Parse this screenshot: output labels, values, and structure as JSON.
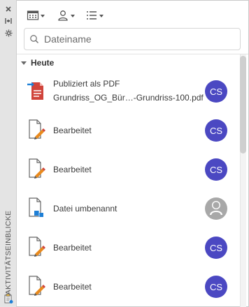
{
  "palette": {
    "side_label": "AKTIVITÄTSEINBLICKE",
    "controls": [
      "close-icon",
      "minimize-icon",
      "settings-icon"
    ]
  },
  "toolbar": {
    "buttons": [
      "calendar-filter-icon",
      "user-filter-icon",
      "list-view-icon"
    ]
  },
  "search": {
    "placeholder": "Dateiname",
    "value": ""
  },
  "group": {
    "label": "Heute"
  },
  "items": [
    {
      "icon": "pdf-publish-icon",
      "line1": "Publiziert als PDF",
      "line2": "Grundriss_OG_Bür…-Grundriss-100.pdf",
      "avatar": "CS"
    },
    {
      "icon": "file-edit-icon",
      "line1": "Bearbeitet",
      "avatar": "CS"
    },
    {
      "icon": "file-edit-icon",
      "line1": "Bearbeitet",
      "avatar": "CS"
    },
    {
      "icon": "file-rename-icon",
      "line1": "Datei umbenannt",
      "avatar": ""
    },
    {
      "icon": "file-edit-icon",
      "line1": "Bearbeitet",
      "avatar": "CS"
    },
    {
      "icon": "file-edit-icon",
      "line1": "Bearbeitet",
      "avatar": "CS"
    }
  ],
  "colors": {
    "avatar": "#4b48c2",
    "avatar_unknown": "#a8a8a8",
    "pdf_red": "#d0443b",
    "pencil_orange": "#e98a1d",
    "accent_blue": "#1e7fd6"
  }
}
